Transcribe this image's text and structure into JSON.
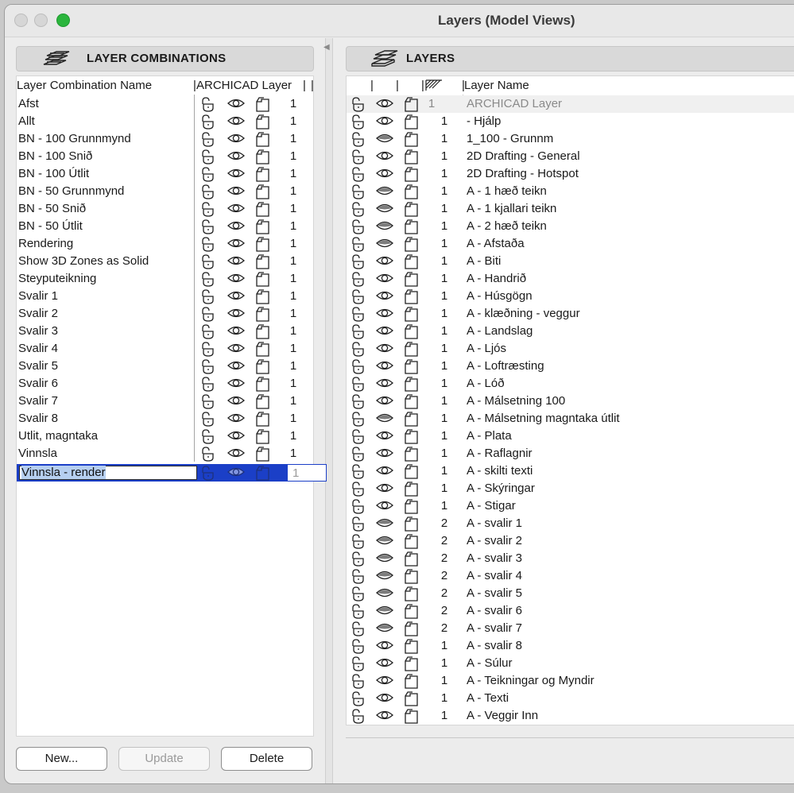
{
  "window": {
    "title": "Layers (Model Views)"
  },
  "left": {
    "section_title": "LAYER COMBINATIONS",
    "col_name": "Layer Combination Name",
    "col_layer": "ARCHICAD Layer",
    "rows": [
      {
        "name": "Afst",
        "num": "1"
      },
      {
        "name": "Allt",
        "num": "1"
      },
      {
        "name": "BN - 100 Grunnmynd",
        "num": "1"
      },
      {
        "name": "BN - 100 Snið",
        "num": "1"
      },
      {
        "name": "BN - 100 Útlit",
        "num": "1"
      },
      {
        "name": "BN - 50 Grunnmynd",
        "num": "1"
      },
      {
        "name": "BN - 50 Snið",
        "num": "1"
      },
      {
        "name": "BN - 50 Útlit",
        "num": "1"
      },
      {
        "name": "Rendering",
        "num": "1"
      },
      {
        "name": "Show 3D Zones as Solid",
        "num": "1"
      },
      {
        "name": "Steyputeikning",
        "num": "1"
      },
      {
        "name": "Svalir 1",
        "num": "1"
      },
      {
        "name": "Svalir 2",
        "num": "1"
      },
      {
        "name": "Svalir 3",
        "num": "1"
      },
      {
        "name": "Svalir 4",
        "num": "1"
      },
      {
        "name": "Svalir 5",
        "num": "1"
      },
      {
        "name": "Svalir 6",
        "num": "1"
      },
      {
        "name": "Svalir 7",
        "num": "1"
      },
      {
        "name": "Svalir 8",
        "num": "1"
      },
      {
        "name": "Utlit, magntaka",
        "num": "1"
      },
      {
        "name": "Vinnsla",
        "num": "1"
      }
    ],
    "editing_row": {
      "name": "Vinnsla - render",
      "num": "1"
    },
    "buttons": {
      "new": "New...",
      "update": "Update",
      "delete": "Delete"
    }
  },
  "right": {
    "section_title": "LAYERS",
    "col_name": "Layer Name",
    "rows": [
      {
        "name": "ARCHICAD Layer",
        "num": "1",
        "eye": "open"
      },
      {
        "name": "- Hjálp",
        "num": "1",
        "eye": "open"
      },
      {
        "name": "1_100 - Grunnm",
        "num": "1",
        "eye": "closed"
      },
      {
        "name": "2D Drafting - General",
        "num": "1",
        "eye": "open"
      },
      {
        "name": "2D Drafting - Hotspot",
        "num": "1",
        "eye": "open"
      },
      {
        "name": "A - 1 hæð teikn",
        "num": "1",
        "eye": "closed"
      },
      {
        "name": "A - 1 kjallari teikn",
        "num": "1",
        "eye": "closed"
      },
      {
        "name": "A - 2 hæð teikn",
        "num": "1",
        "eye": "closed"
      },
      {
        "name": "A - Afstaða",
        "num": "1",
        "eye": "closed"
      },
      {
        "name": "A - Biti",
        "num": "1",
        "eye": "open"
      },
      {
        "name": "A - Handrið",
        "num": "1",
        "eye": "open"
      },
      {
        "name": "A - Húsgögn",
        "num": "1",
        "eye": "open"
      },
      {
        "name": "A - klæðning - veggur",
        "num": "1",
        "eye": "open"
      },
      {
        "name": "A - Landslag",
        "num": "1",
        "eye": "open"
      },
      {
        "name": "A - Ljós",
        "num": "1",
        "eye": "open"
      },
      {
        "name": "A - Loftræsting",
        "num": "1",
        "eye": "open"
      },
      {
        "name": "A - Lóð",
        "num": "1",
        "eye": "open"
      },
      {
        "name": "A - Málsetning 100",
        "num": "1",
        "eye": "open"
      },
      {
        "name": "A - Málsetning magntaka útlit",
        "num": "1",
        "eye": "closed"
      },
      {
        "name": "A - Plata",
        "num": "1",
        "eye": "open"
      },
      {
        "name": "A - Raflagnir",
        "num": "1",
        "eye": "open"
      },
      {
        "name": "A - skilti texti",
        "num": "1",
        "eye": "open"
      },
      {
        "name": "A - Skýringar",
        "num": "1",
        "eye": "open"
      },
      {
        "name": "A - Stigar",
        "num": "1",
        "eye": "open"
      },
      {
        "name": "A - svalir 1",
        "num": "2",
        "eye": "closed"
      },
      {
        "name": "A - svalir 2",
        "num": "2",
        "eye": "closed"
      },
      {
        "name": "A - svalir 3",
        "num": "2",
        "eye": "closed"
      },
      {
        "name": "A - svalir 4",
        "num": "2",
        "eye": "closed"
      },
      {
        "name": "A - svalir 5",
        "num": "2",
        "eye": "closed"
      },
      {
        "name": "A - svalir 6",
        "num": "2",
        "eye": "closed"
      },
      {
        "name": "A - svalir 7",
        "num": "2",
        "eye": "closed"
      },
      {
        "name": "A - svalir 8",
        "num": "1",
        "eye": "open"
      },
      {
        "name": "A - Súlur",
        "num": "1",
        "eye": "open"
      },
      {
        "name": "A - Teikningar og Myndir",
        "num": "1",
        "eye": "open"
      },
      {
        "name": "A - Texti",
        "num": "1",
        "eye": "open"
      },
      {
        "name": "A - Veggir Inn",
        "num": "1",
        "eye": "open"
      }
    ]
  }
}
